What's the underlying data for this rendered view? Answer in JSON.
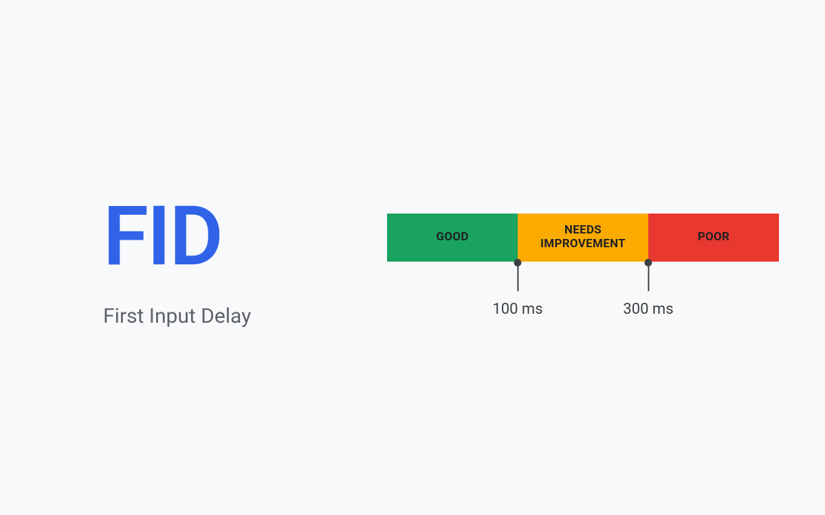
{
  "metric": {
    "acronym": "FID",
    "fullname": "First Input Delay"
  },
  "scale": {
    "segments": {
      "good": {
        "label": "GOOD",
        "color": "#1aa260"
      },
      "needs": {
        "label": "NEEDS IMPROVEMENT",
        "color": "#fbab00"
      },
      "poor": {
        "label": "POOR",
        "color": "#e8382f"
      }
    },
    "thresholds": {
      "t1": "100 ms",
      "t2": "300 ms"
    }
  }
}
